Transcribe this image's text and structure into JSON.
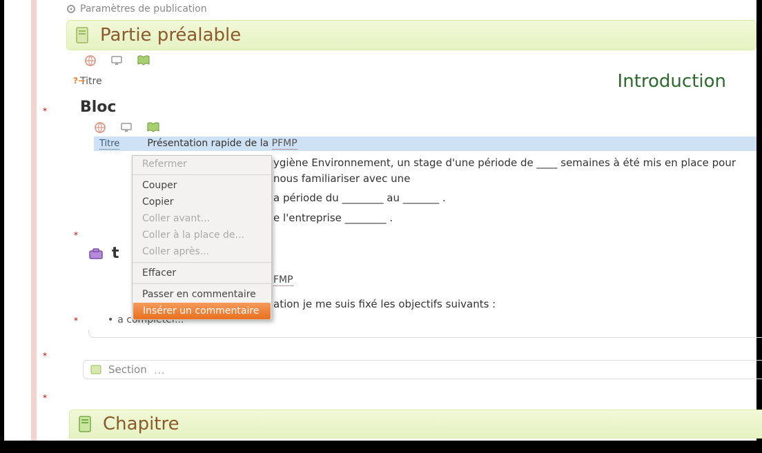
{
  "settings_label": "Paramètres de publication",
  "part_header": "Partie préalable",
  "qarrow": "?→",
  "title_label": "Titre",
  "title_value": "Introduction",
  "bloc_heading": "Bloc",
  "titre2_label": "Titre",
  "titre2_value_prefix": "Présentation rapide de la ",
  "titre2_value_abbr": "PFMP",
  "para1_text": "ygiène Environnement, un stage d'une période de ____ semaines à été mis en place pour nous familiariser avec une",
  "para2_text": "a période du ________ au _______ .",
  "para3_text": "e l'entreprise ________ .",
  "toolbox_tail": "t",
  "fmp_label": "FMP",
  "objectives_text": "ation je me suis fixé les objectifs suivants :",
  "completer_text": "a completer...",
  "section_label": "Section",
  "chapter_title": "Chapitre",
  "menu": {
    "refermer": "Refermer",
    "couper": "Couper",
    "copier": "Copier",
    "coller_avant": "Coller avant...",
    "coller_place": "Coller à la place de...",
    "coller_apres": "Coller après...",
    "effacer": "Effacer",
    "passer_comment": "Passer en commentaire",
    "inserer_comment": "Insérer un commentaire"
  },
  "asterisk": "*"
}
